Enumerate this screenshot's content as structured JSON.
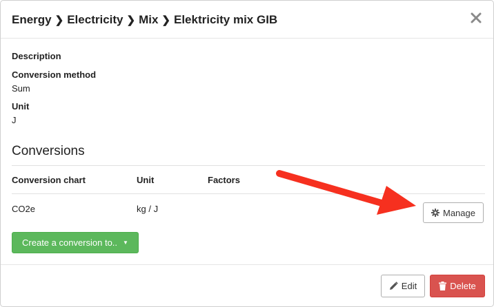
{
  "header": {
    "breadcrumb": [
      "Energy",
      "Electricity",
      "Mix",
      "Elektricity mix GIB"
    ],
    "separator": "›"
  },
  "details": {
    "description_label": "Description",
    "conversion_method_label": "Conversion method",
    "conversion_method_value": "Sum",
    "unit_label": "Unit",
    "unit_value": "J"
  },
  "conversions": {
    "title": "Conversions",
    "columns": [
      "Conversion chart",
      "Unit",
      "Factors"
    ],
    "rows": [
      {
        "chart": "CO2e",
        "unit": "kg / J",
        "factors": "",
        "action_label": "Manage"
      }
    ],
    "create_label": "Create a conversion to.."
  },
  "footer": {
    "edit_label": "Edit",
    "delete_label": "Delete"
  },
  "colors": {
    "create_button": "#5cb85c",
    "delete_button": "#d9534f",
    "arrow": "#f6301f"
  },
  "icons": {
    "close": "close-icon",
    "manage": "gear-icon",
    "edit": "pencil-icon",
    "delete": "trash-icon"
  }
}
